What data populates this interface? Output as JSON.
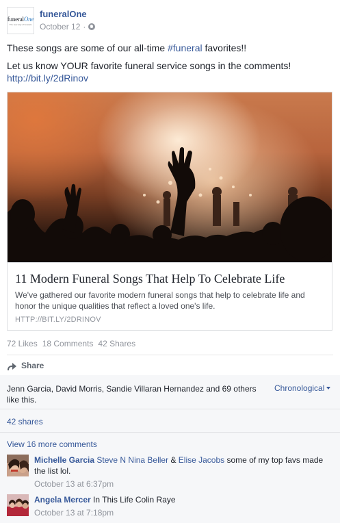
{
  "page": {
    "logo_word": "funeral",
    "logo_accent": "One",
    "logo_tagline": "The new way of funerals",
    "name": "funeralOne",
    "date": "October 12",
    "date_separator": "·"
  },
  "message": {
    "line1_prefix": "These songs are some of our all-time ",
    "hashtag": "#funeral",
    "line1_suffix": " favorites!!",
    "line2": "Let us know YOUR favorite funeral service songs in the comments!",
    "link": "http://bit.ly/2dRinov"
  },
  "card": {
    "title": "11 Modern Funeral Songs That Help To Celebrate Life",
    "description": "We've gathered our favorite modern funeral songs that help to celebrate life and honor the unique qualities that reflect a loved one's life.",
    "domain": "HTTP://BIT.LY/2DRINOV"
  },
  "stats": {
    "likes": "72 Likes",
    "comments": "18 Comments",
    "shares": "42 Shares"
  },
  "actions": {
    "share_label": "Share",
    "share_icon": "share-arrow-icon"
  },
  "ufi": {
    "likes_text": "Jenn Garcia, David Morris, Sandie Villaran Hernandez and 69 others like this.",
    "order_label": "Chronological",
    "shares_link": "42 shares",
    "more_comments": "View 16 more comments"
  },
  "comments": [
    {
      "name": "Michelle Garcia",
      "tag1": "Steve N Nina Beller",
      "connector": " & ",
      "tag2": "Elise Jacobs",
      "text": " some of my top favs made the list lol.",
      "time": "October 13 at 6:37pm"
    },
    {
      "name": "Angela Mercer",
      "text": " In This Life Colin Raye",
      "time": "October 13 at 7:18pm"
    }
  ],
  "colors": {
    "link": "#365899",
    "meta": "#90949c",
    "ufi_background": "#f6f7f9"
  }
}
